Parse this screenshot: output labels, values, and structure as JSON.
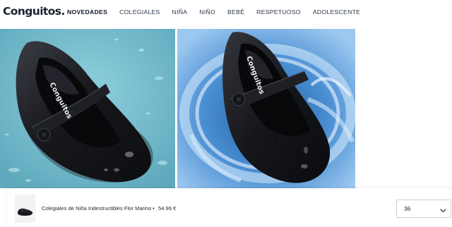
{
  "header": {
    "logo_text": "Conguitos",
    "logo_dot": ".",
    "nav": [
      {
        "label": "NOVEDADES",
        "active": true
      },
      {
        "label": "COLEGIALES",
        "active": false
      },
      {
        "label": "NIÑA",
        "active": false
      },
      {
        "label": "NIÑO",
        "active": false
      },
      {
        "label": "BEBÉ",
        "active": false
      },
      {
        "label": "RESPETUOSO",
        "active": false
      },
      {
        "label": "ADOLESCENTE",
        "active": false
      }
    ]
  },
  "gallery": {
    "images": [
      {
        "label": "Conguitos",
        "background": "#79b9c9"
      },
      {
        "label": "Conguitos",
        "background": "#6fa6df"
      }
    ]
  },
  "sticky_bar": {
    "product_name": "Colegiales de Niña Indestructibles Flor Marino",
    "separator": "•",
    "price": "54.99 €",
    "size_selected": "36",
    "chevron_icon": "chevron-down-icon"
  },
  "colors": {
    "text_dark": "#1b2230",
    "photo_left_bg": "#79b9c9",
    "photo_right_bg": "#6fa6df",
    "shoe": "#1a1b1f"
  }
}
